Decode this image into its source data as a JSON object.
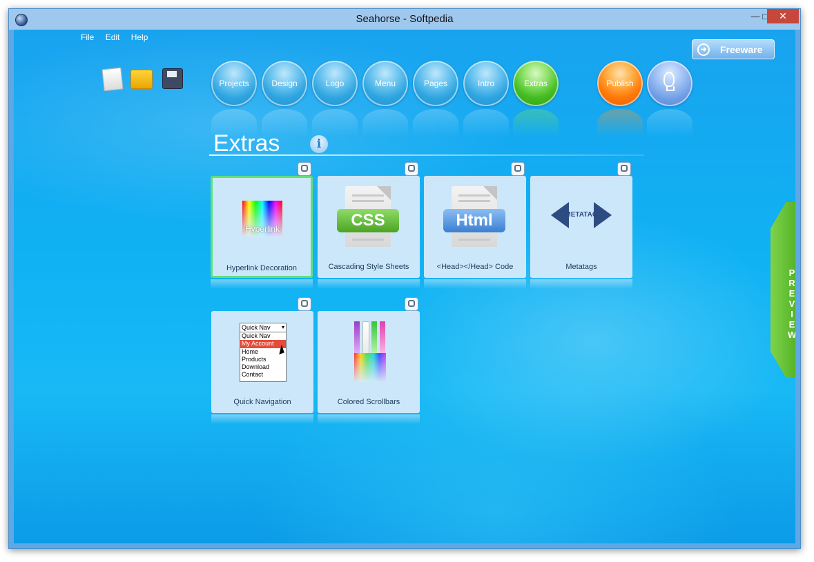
{
  "window": {
    "title": "Seahorse - Softpedia"
  },
  "menu": [
    "File",
    "Edit",
    "Help"
  ],
  "toolbar_icons": [
    "new-file-icon",
    "open-folder-icon",
    "save-disk-icon"
  ],
  "nav": {
    "tabs": [
      "Projects",
      "Design",
      "Logo",
      "Menu",
      "Pages",
      "Intro",
      "Extras"
    ],
    "active": "Extras",
    "publish": "Publish"
  },
  "freeware_label": "Freeware",
  "section": {
    "title": "Extras"
  },
  "tiles": [
    {
      "caption": "Hyperlink Decoration",
      "image_text": "Hyperlink",
      "selected": true
    },
    {
      "caption": "Cascading Style Sheets",
      "image_text": "CSS"
    },
    {
      "caption": "<Head></Head> Code",
      "image_text": "Html"
    },
    {
      "caption": "Metatags",
      "image_text": "METATAG"
    },
    {
      "caption": "Quick Navigation",
      "dropdown_value": "Quick Nav",
      "items": [
        "Quick Nav",
        "My Account",
        "Home",
        "Products",
        "Download",
        "Contact"
      ],
      "highlighted": "My Account"
    },
    {
      "caption": "Colored Scrollbars"
    }
  ],
  "preview_label": "PREVIEW",
  "colors": {
    "accent_green": "#47a91d",
    "publish_orange": "#ff7a09",
    "background_blue": "#10b2f4"
  }
}
